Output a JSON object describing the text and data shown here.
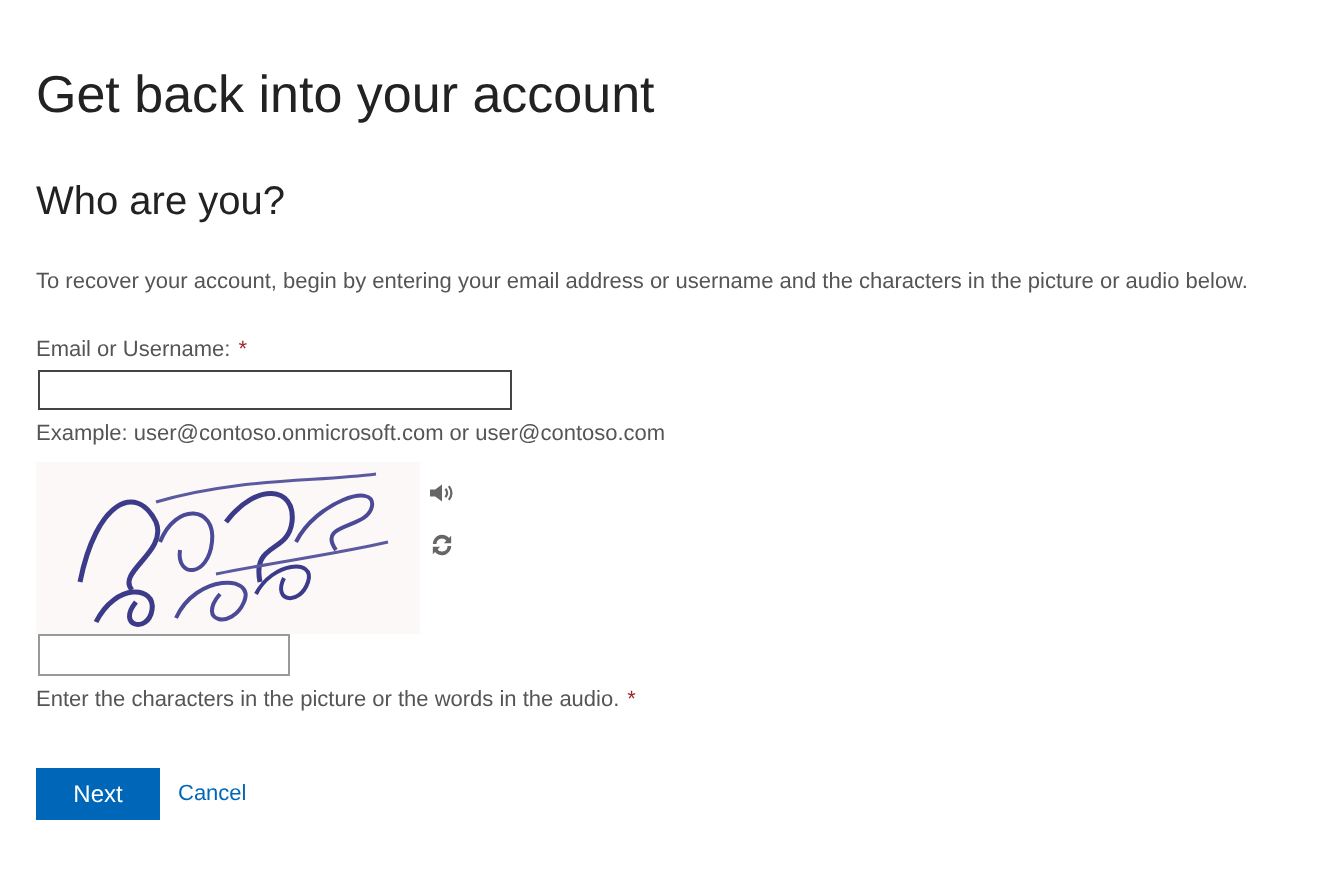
{
  "title": "Get back into your account",
  "subtitle": "Who are you?",
  "intro": "To recover your account, begin by entering your email address or username and the characters in the picture or audio below.",
  "email_field": {
    "label": "Email or Username:",
    "required_mark": "*"
  },
  "example": "Example: user@contoso.onmicrosoft.com or user@contoso.com",
  "captcha_field": {
    "hint": "Enter the characters in the picture or the words in the audio.",
    "required_mark": "*"
  },
  "buttons": [
    {
      "label": "Next",
      "kind": "primary"
    },
    {
      "label": "Cancel",
      "kind": "link"
    }
  ]
}
